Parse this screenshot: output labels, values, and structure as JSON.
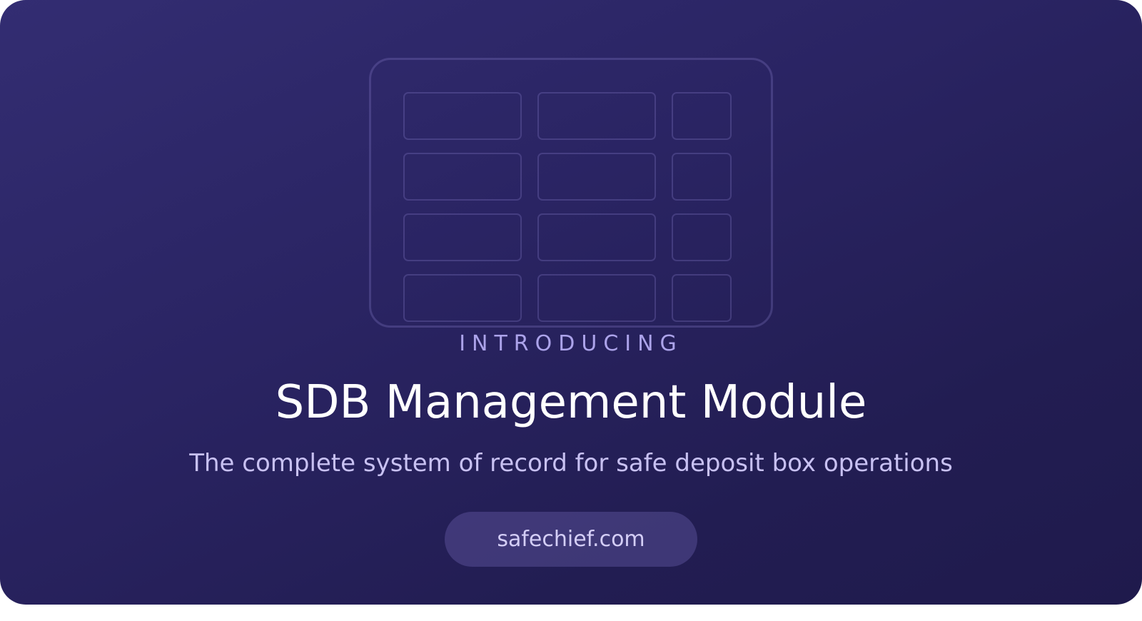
{
  "hero": {
    "eyebrow": "INTRODUCING",
    "title": "SDB Management Module",
    "subtitle": "The complete system of record for safe deposit box operations",
    "url_label": "safechief.com"
  },
  "illustration": {
    "icon": "safe-deposit-box-grid-icon",
    "rows": 4,
    "columns": 3
  },
  "colors": {
    "background_start": "#332d72",
    "background_end": "#1f1a4c",
    "eyebrow": "#aca3ea",
    "title": "#ffffff",
    "subtitle": "#c8c1f2",
    "pill_text": "#d4cef6"
  }
}
